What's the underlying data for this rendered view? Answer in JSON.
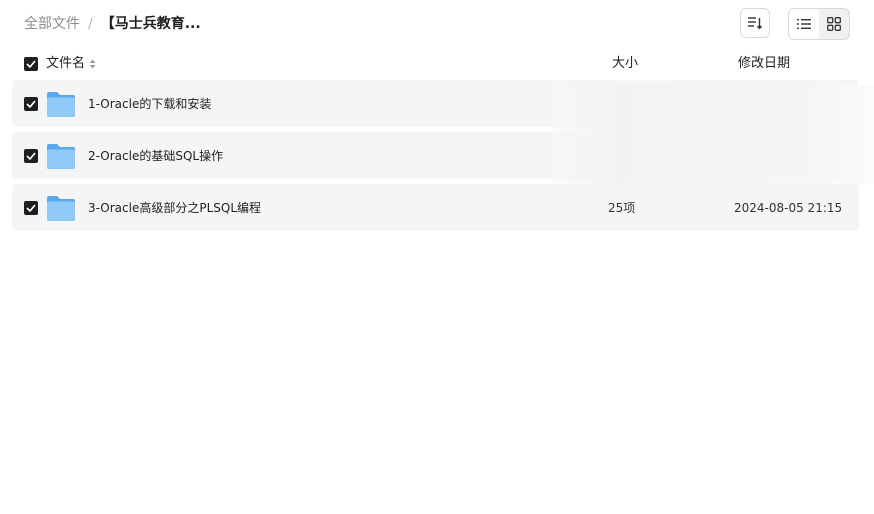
{
  "breadcrumb": {
    "root": "全部文件",
    "separator": "/",
    "current": "【马士兵教育..."
  },
  "toolbar": {
    "sort_icon": "sort-icon",
    "list_view_icon": "list-view-icon",
    "grid_view_icon": "grid-view-icon"
  },
  "table": {
    "headers": {
      "name": "文件名",
      "size": "大小",
      "modified": "修改日期"
    },
    "rows": [
      {
        "name": "1-Oracle的下载和安装",
        "size": "",
        "date": "",
        "checked": true
      },
      {
        "name": "2-Oracle的基础SQL操作",
        "size": "",
        "date": "",
        "checked": true
      },
      {
        "name": "3-Oracle高级部分之PLSQL编程",
        "size": "25项",
        "date": "2024-08-05 21:15",
        "checked": true
      }
    ]
  },
  "colors": {
    "checkbox": "#1f1f1f",
    "row_background": "#f5f5f5",
    "folder": "#6fb6f2"
  }
}
